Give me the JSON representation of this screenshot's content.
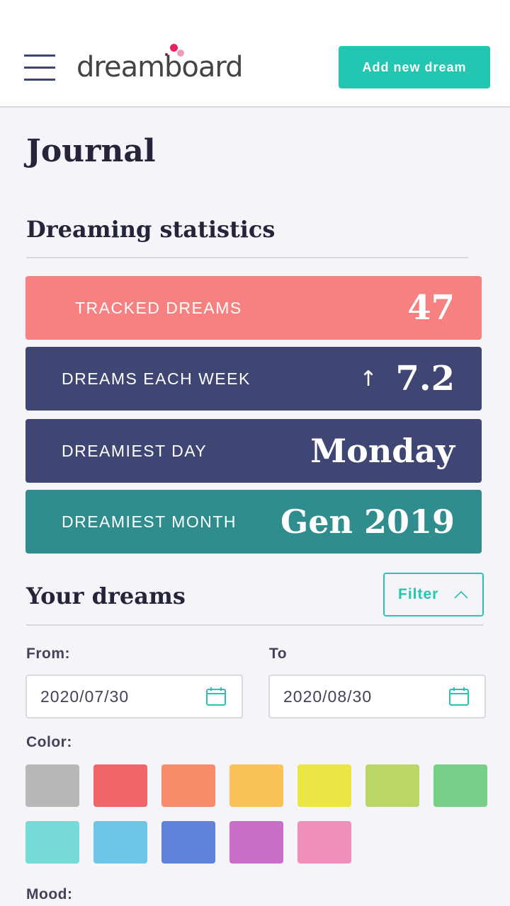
{
  "header": {
    "menu_icon": "hamburger-menu-icon",
    "logo_text": "dreamboard",
    "add_button_label": "Add new dream"
  },
  "page": {
    "title": "Journal"
  },
  "statistics": {
    "title": "Dreaming statistics",
    "cards": [
      {
        "label": "TRACKED DREAMS",
        "value": "47",
        "color": "#f78080"
      },
      {
        "label": "DREAMS EACH WEEK",
        "value": "7.2",
        "trend_icon": "arrow-up-icon",
        "trend": "↑",
        "color": "#404673"
      },
      {
        "label": "DREAMIEST DAY",
        "value": "Monday",
        "color": "#404673"
      },
      {
        "label": "DREAMIEST MONTH",
        "value": "Gen 2019",
        "color": "#2f8d8d"
      }
    ]
  },
  "dreams": {
    "title": "Your dreams",
    "filter_button_label": "Filter",
    "filter_icon": "chevron-up-icon",
    "from_label": "From:",
    "from_value": "2020/07/30",
    "to_label": "To",
    "to_value": "2020/08/30",
    "calendar_icon": "calendar-icon",
    "color_label": "Color:",
    "colors": [
      "#b8b8b8",
      "#f06568",
      "#f78b6a",
      "#fac359",
      "#ebe645",
      "#bad665",
      "#77d087",
      "#76dbd6",
      "#6dc6e6",
      "#6083d9",
      "#c96fca",
      "#f08fba"
    ],
    "mood_label": "Mood:"
  },
  "theme": {
    "accent": "#22c6b1",
    "navy": "#404673",
    "background": "#f4f4f9"
  }
}
